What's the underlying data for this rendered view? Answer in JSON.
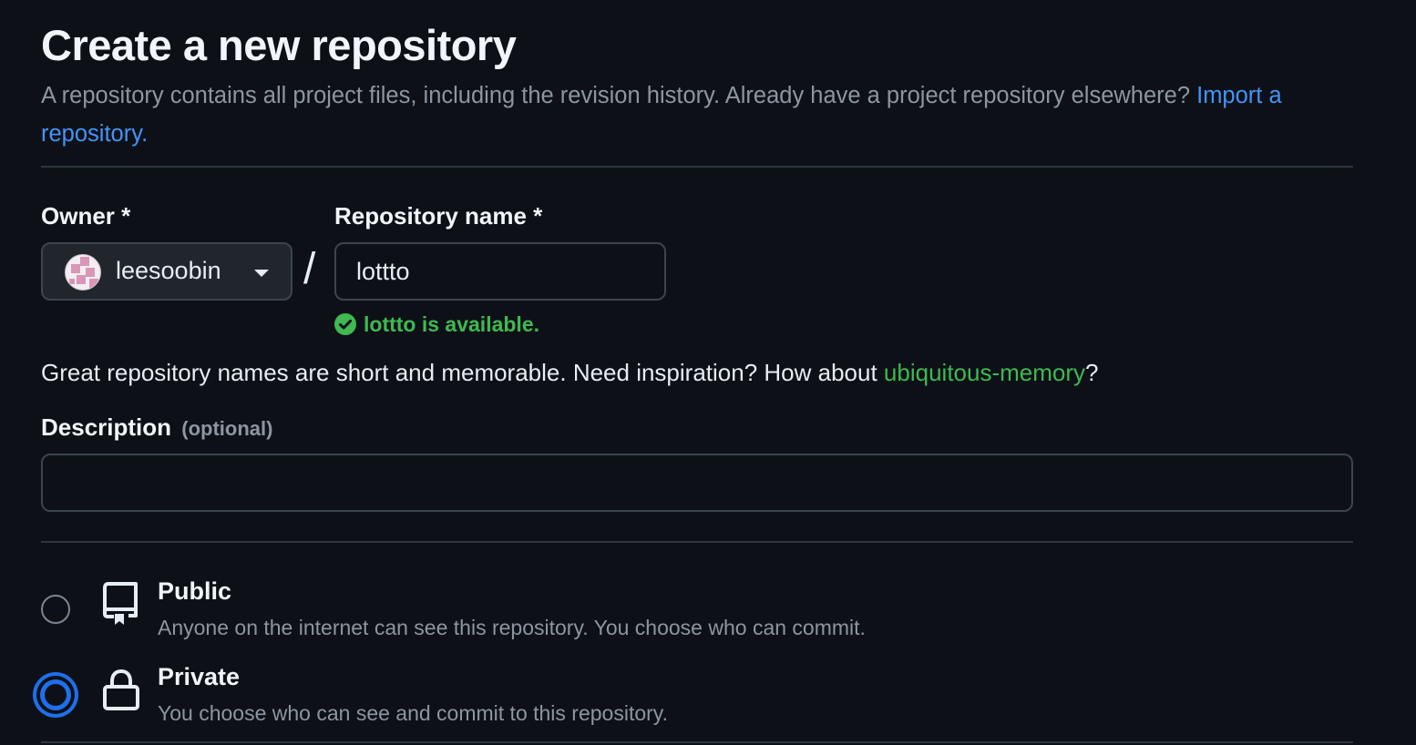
{
  "page": {
    "title": "Create a new repository",
    "subtitle": "A repository contains all project files, including the revision history. Already have a project repository elsewhere?",
    "import_link": "Import a repository."
  },
  "owner": {
    "label": "Owner *",
    "value": "leesoobin",
    "icon": "chevron-down-icon"
  },
  "separator": "/",
  "repo_name": {
    "label": "Repository name *",
    "value": "lottto",
    "availability": "lottto is available.",
    "availability_color": "#3fb950"
  },
  "suggestion": {
    "prefix": "Great repository names are short and memorable. Need inspiration? How about ",
    "name": "ubiquitous-memory",
    "suffix": "?"
  },
  "description": {
    "label": "Description",
    "optional": "(optional)",
    "value": ""
  },
  "visibility": {
    "selected": "private",
    "options": [
      {
        "id": "public",
        "title": "Public",
        "description": "Anyone on the internet can see this repository. You choose who can commit.",
        "icon": "repo-icon"
      },
      {
        "id": "private",
        "title": "Private",
        "description": "You choose who can see and commit to this repository.",
        "icon": "lock-icon"
      }
    ]
  },
  "colors": {
    "background": "#0d1117",
    "link": "#4493f8",
    "success": "#3fb950",
    "accent": "#1f6feb"
  }
}
